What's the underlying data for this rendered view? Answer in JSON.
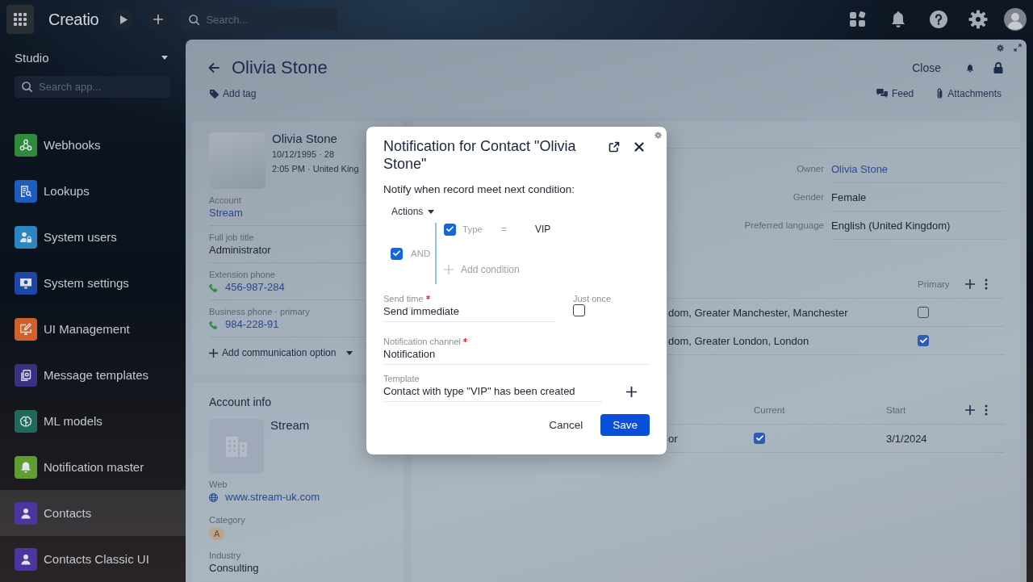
{
  "top_bar": {
    "logo": "Creatio",
    "search": {
      "placeholder": "Search..."
    }
  },
  "sidebar": {
    "workspace": "Studio",
    "search": {
      "placeholder": "Search app..."
    },
    "items": [
      {
        "label": "Webhooks",
        "color": "#2f8a3c",
        "selected": false
      },
      {
        "label": "Lookups",
        "color": "#1f5cbf",
        "selected": false
      },
      {
        "label": "System users",
        "color": "#2b85c0",
        "selected": false
      },
      {
        "label": "System settings",
        "color": "#1c46a8",
        "selected": false
      },
      {
        "label": "UI Management",
        "color": "#d2602a",
        "selected": false
      },
      {
        "label": "Message templates",
        "color": "#3b3082",
        "selected": false
      },
      {
        "label": "ML models",
        "color": "#1f6a5b",
        "selected": false
      },
      {
        "label": "Notification master",
        "color": "#5e9d2f",
        "selected": false
      },
      {
        "label": "Contacts",
        "color": "#4d35a0",
        "selected": true
      },
      {
        "label": "Contacts Classic UI",
        "color": "#4d35a0",
        "selected": false
      }
    ]
  },
  "page": {
    "title": "Olivia Stone",
    "close": "Close",
    "add_tag": "Add tag",
    "feed": "Feed",
    "attachments": "Attachments"
  },
  "profile_card": {
    "name": "Olivia Stone",
    "birth": "10/12/1995 · 28",
    "local_time": "2:05 PM · United King",
    "fields": [
      {
        "label": "Account",
        "value": "Stream",
        "kind": "link"
      },
      {
        "label": "Full job title",
        "value": "Administrator",
        "kind": "text"
      },
      {
        "label": "Extension phone",
        "value": "456-987-284",
        "kind": "phone"
      },
      {
        "label": "Business phone · primary",
        "value": "984-228-91",
        "kind": "phone"
      }
    ],
    "add_option": "Add communication option"
  },
  "account_card": {
    "title": "Account info",
    "name": "Stream",
    "fields": [
      {
        "label": "Web",
        "value": "www.stream-uk.com",
        "kind": "web"
      },
      {
        "label": "Category",
        "value": "A",
        "kind": "badge"
      },
      {
        "label": "Industry",
        "value": "Consulting",
        "kind": "text"
      }
    ]
  },
  "details": {
    "fields": [
      {
        "label": "Owner",
        "value": "Olivia Stone",
        "kind": "link"
      },
      {
        "label": "Gender",
        "value": "Female",
        "kind": "text"
      },
      {
        "label": "Preferred language",
        "value": "English (United Kingdom)",
        "kind": "text"
      }
    ]
  },
  "addresses": {
    "columns": [
      "Primary"
    ],
    "rows": [
      {
        "address": "dom, Greater Manchester, Manchester",
        "primary": false
      },
      {
        "address": "dom, Greater London, London",
        "primary": true
      }
    ]
  },
  "career": {
    "columns": [
      "Current",
      "Start"
    ],
    "rows": [
      {
        "column_1": "or",
        "current": true,
        "start": "3/1/2024"
      }
    ]
  },
  "dialog": {
    "title": "Notification for Contact \"Olivia Stone\"",
    "intro": "Notify when record meet next condition:",
    "actions": "Actions",
    "group": {
      "operator": "AND",
      "checked": true,
      "conditions": [
        {
          "field": "Type",
          "operator": "=",
          "value": "VIP",
          "checked": true
        }
      ],
      "add_condition": "Add condition"
    },
    "send_time": {
      "label": "Send time",
      "required": true,
      "value": "Send immediate"
    },
    "just_once": {
      "label": "Just once",
      "checked": false
    },
    "channel": {
      "label": "Notification channel",
      "required": true,
      "value": "Notification"
    },
    "template": {
      "label": "Template",
      "value": "Contact with type \"VIP\" has been created"
    },
    "buttons": [
      {
        "label": "Cancel",
        "kind": "secondary"
      },
      {
        "label": "Save",
        "kind": "primary"
      }
    ]
  }
}
